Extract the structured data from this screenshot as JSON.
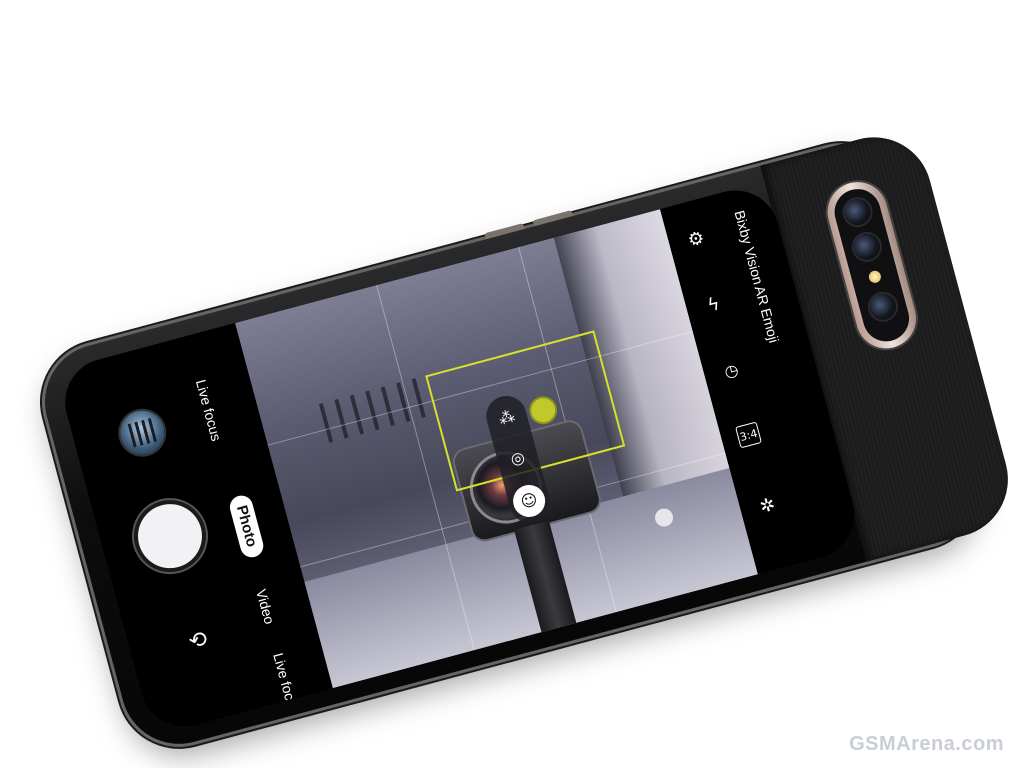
{
  "modes": {
    "top": "Live focus",
    "active": "Photo",
    "video": "Video",
    "bottom": "Live focus"
  },
  "settings": {
    "bixby_vision": "Bixby Vision",
    "ar_emoji": "AR Emoji",
    "ratio": "3:4"
  },
  "icons": {
    "settings": "gear-icon",
    "flash": "flash-off-icon",
    "timer": "timer-off-icon",
    "ratio": "aspect-ratio-icon",
    "effects": "sparkle-icon",
    "switch_camera": "switch-camera-icon",
    "gallery": "gallery-thumbnail"
  },
  "colors": {
    "focus_box": "#d7e02a",
    "shutter": "#f2f2f4",
    "active_mode_bg": "#ffffff"
  },
  "watermark": "GSMArena.com"
}
